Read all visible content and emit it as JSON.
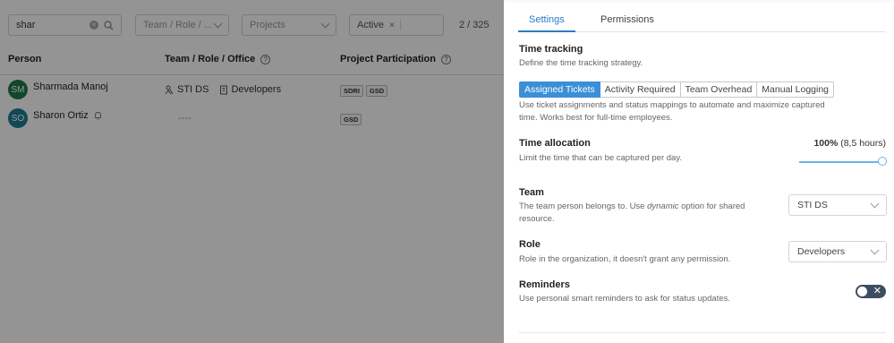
{
  "filters": {
    "search_value": "shar",
    "team_placeholder": "Team / Role / ...",
    "projects_placeholder": "Projects",
    "status_tag": "Active",
    "status_tag_remove": "×",
    "counter": "2 / 325"
  },
  "table": {
    "columns": [
      "Person",
      "Team / Role / Office",
      "Project Participation"
    ],
    "rows": [
      {
        "initials": "SM",
        "avatar_color": "#1f7a4c",
        "name": "Sharmada Manoj",
        "team": "STI DS",
        "role": "Developers",
        "projects": [
          "SDRI",
          "GSD"
        ]
      },
      {
        "initials": "SO",
        "avatar_color": "#1b7f95",
        "name": "Sharon Ortiz",
        "team": "----",
        "projects": [
          "GSD"
        ]
      }
    ]
  },
  "panel": {
    "tabs": [
      "Settings",
      "Permissions"
    ],
    "active_tab": "Settings",
    "time_tracking": {
      "title": "Time tracking",
      "desc": "Define the time tracking strategy.",
      "options": [
        "Assigned Tickets",
        "Activity Required",
        "Team Overhead",
        "Manual Logging"
      ],
      "selected": "Assigned Tickets",
      "help_line1": "Use ticket assignments and status mappings to automate and maximize captured",
      "help_line2": "time. Works best for full-time employees."
    },
    "time_allocation": {
      "title": "Time allocation",
      "desc": "Limit the time that can be captured per day.",
      "value_pct": "100%",
      "value_hours": "(8,5 hours)",
      "slider_fraction": 1.0
    },
    "team": {
      "title": "Team",
      "desc_pre": "The team person belongs to. Use ",
      "desc_em": "dynamic",
      "desc_post": " option for shared",
      "desc_line2": "resource.",
      "value": "STI DS"
    },
    "role": {
      "title": "Role",
      "desc": "Role in the organization, it doesn't grant any permission.",
      "value": "Developers"
    },
    "reminders": {
      "title": "Reminders",
      "desc": "Use personal smart reminders to ask for status updates.",
      "toggle_symbol": "✕",
      "enabled": false
    }
  },
  "colors": {
    "accent": "#3b8fd8",
    "tab_active": "#2a7dc4",
    "toggle_off": "#3d4e63",
    "overlay": "rgba(0,0,0,0.42)"
  }
}
